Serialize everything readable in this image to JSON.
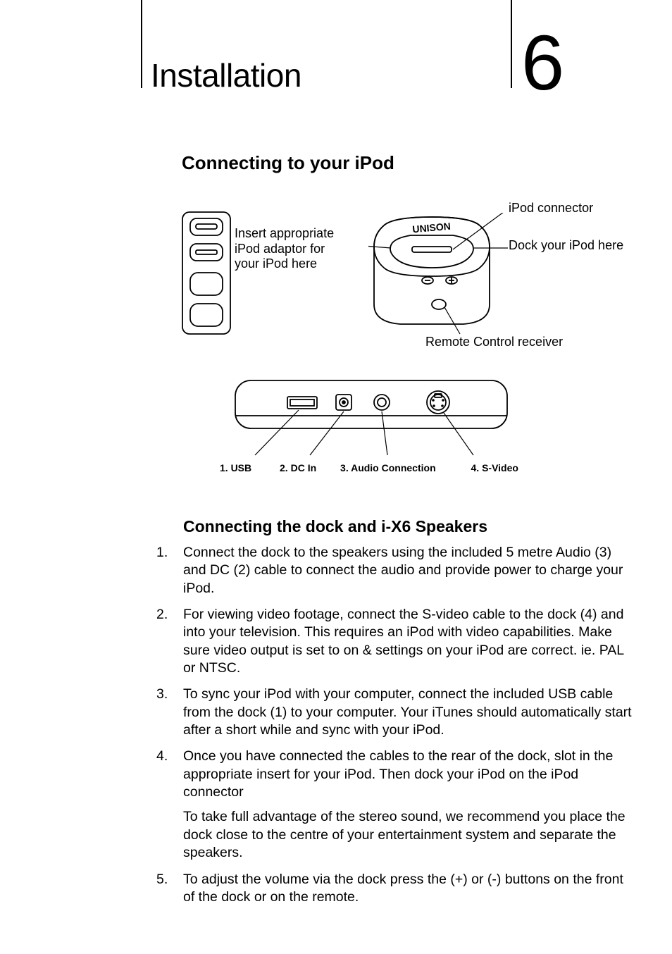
{
  "header": {
    "title": "Installation",
    "page_number": "6"
  },
  "section1": {
    "title": "Connecting to your iPod"
  },
  "diagram_top": {
    "adaptor_label_l1": "Insert appropriate",
    "adaptor_label_l2": "iPod adaptor for",
    "adaptor_label_l3": "your iPod here",
    "brand": "UNISON",
    "connector_label": "iPod connector",
    "dock_here_label": "Dock your iPod here",
    "remote_label": "Remote Control receiver"
  },
  "diagram_rear": {
    "port1": "1. USB",
    "port2": "2. DC In",
    "port3": "3. Audio Connection",
    "port4": "4. S-Video"
  },
  "section2": {
    "title": "Connecting the dock and i-X6 Speakers"
  },
  "steps": [
    {
      "n": "1.",
      "t": "Connect the dock to the speakers using the included 5 metre Audio (3) and DC (2) cable to connect the audio and provide power to charge your iPod."
    },
    {
      "n": "2.",
      "t": "For viewing video footage, connect the S-video cable to the dock (4) and into your television. This requires an iPod with video capabilities. Make sure video output is set to on & settings on your iPod are correct. ie. PAL or NTSC."
    },
    {
      "n": "3.",
      "t": "To sync your iPod with your computer, connect the included USB cable from the dock (1) to your computer. Your iTunes should automatically start after a short while and sync with your iPod."
    },
    {
      "n": "4.",
      "t": "Once you have connected the cables to the rear of the dock, slot in the appropriate insert for your iPod. Then dock your iPod on the  iPod connector",
      "t2": "To take full advantage of the stereo sound, we recommend you place the dock close to the centre of your entertainment system and separate the speakers."
    },
    {
      "n": "5.",
      "t": "To adjust the volume via the dock press the (+) or (-) buttons on the front of the dock or on the remote."
    }
  ]
}
